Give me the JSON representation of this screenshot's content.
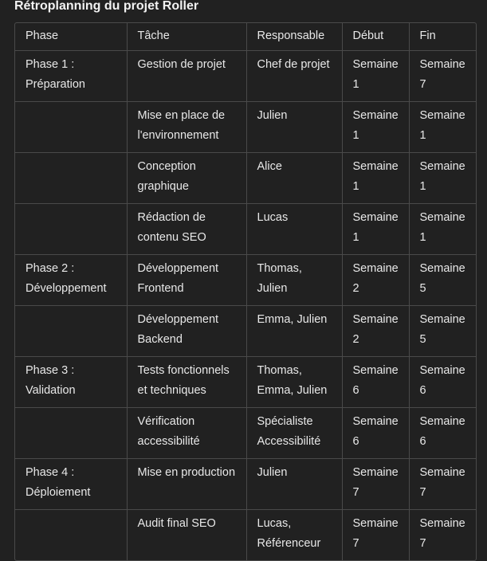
{
  "title": "Rétroplanning du projet Roller",
  "table": {
    "headers": [
      "Phase",
      "Tâche",
      "Responsable",
      "Début",
      "Fin"
    ],
    "rows": [
      [
        "Phase 1 : Préparation",
        "Gestion de projet",
        "Chef de projet",
        "Semaine 1",
        "Semaine 7"
      ],
      [
        "",
        "Mise en place de l'environnement",
        "Julien",
        "Semaine 1",
        "Semaine 1"
      ],
      [
        "",
        "Conception graphique",
        "Alice",
        "Semaine 1",
        "Semaine 1"
      ],
      [
        "",
        "Rédaction de contenu SEO",
        "Lucas",
        "Semaine 1",
        "Semaine 1"
      ],
      [
        "Phase 2 : Développement",
        "Développement Frontend",
        "Thomas, Julien",
        "Semaine 2",
        "Semaine 5"
      ],
      [
        "",
        "Développement Backend",
        "Emma, Julien",
        "Semaine 2",
        "Semaine 5"
      ],
      [
        "Phase 3 : Validation",
        "Tests fonctionnels et techniques",
        "Thomas, Emma, Julien",
        "Semaine 6",
        "Semaine 6"
      ],
      [
        "",
        "Vérification accessibilité",
        "Spécialiste Accessibilité",
        "Semaine 6",
        "Semaine 6"
      ],
      [
        "Phase 4 : Déploiement",
        "Mise en production",
        "Julien",
        "Semaine 7",
        "Semaine 7"
      ],
      [
        "",
        "Audit final SEO",
        "Lucas, Référenceur",
        "Semaine 7",
        "Semaine 7"
      ]
    ]
  }
}
